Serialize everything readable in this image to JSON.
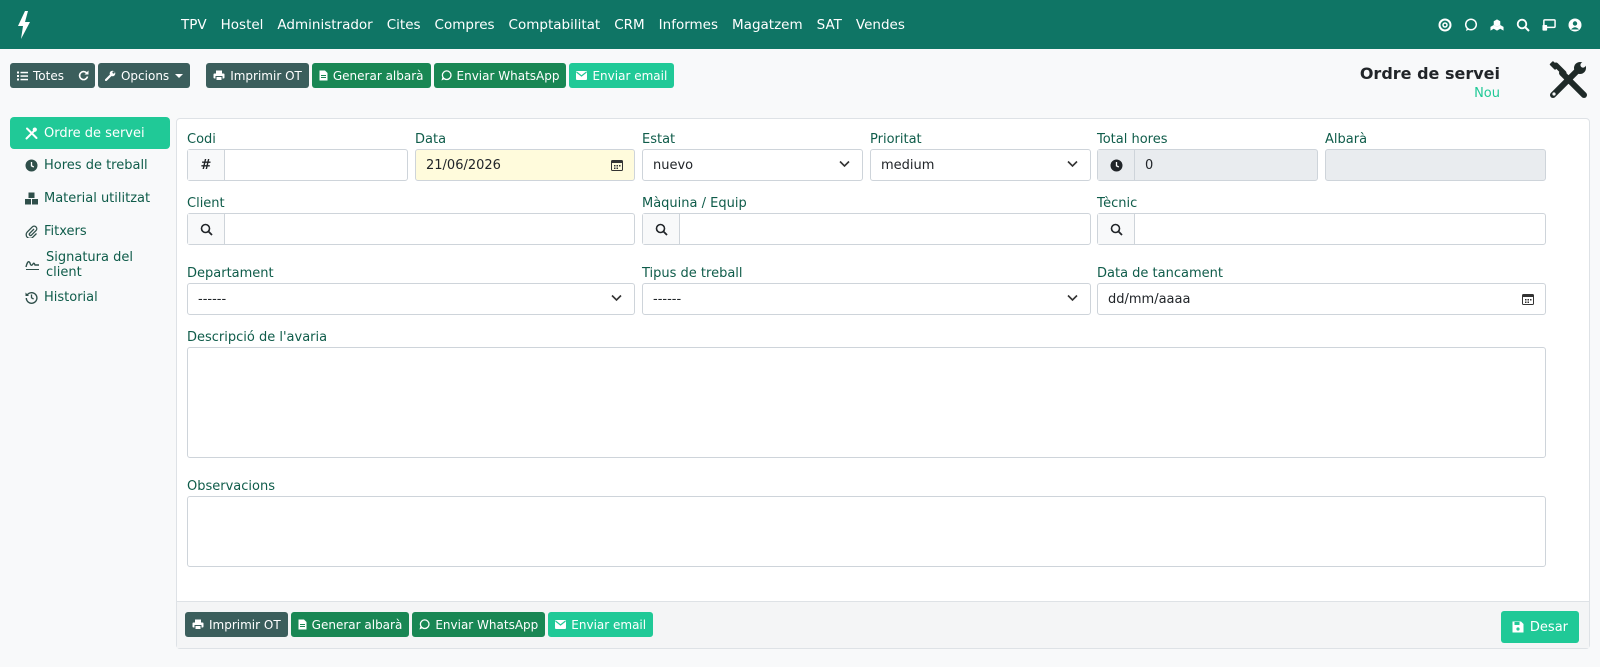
{
  "navbar": {
    "menu": [
      "TPV",
      "Hostel",
      "Administrador",
      "Cites",
      "Compres",
      "Comptabilitat",
      "CRM",
      "Informes",
      "Magatzem",
      "SAT",
      "Vendes"
    ],
    "icons": [
      "support-icon",
      "whatsapp-icon",
      "modules-icon",
      "search-icon",
      "screen-icon",
      "user-icon"
    ]
  },
  "toolbar": {
    "all_label": "Totes",
    "options_label": "Opcions",
    "print_label": "Imprimir OT",
    "invoice_label": "Generar albarà",
    "whatsapp_label": "Enviar WhatsApp",
    "email_label": "Enviar email"
  },
  "header": {
    "title": "Ordre de servei",
    "subtitle": "Nou"
  },
  "sidebar": {
    "items": [
      {
        "label": "Ordre de servei",
        "icon": "tools-icon"
      },
      {
        "label": "Hores de treball",
        "icon": "clock-icon"
      },
      {
        "label": "Material utilitzat",
        "icon": "boxes-icon"
      },
      {
        "label": "Fitxers",
        "icon": "paperclip-icon"
      },
      {
        "label": "Signatura del client",
        "icon": "signature-icon"
      },
      {
        "label": "Historial",
        "icon": "history-icon"
      }
    ]
  },
  "form": {
    "codi": {
      "label": "Codi",
      "value": ""
    },
    "data": {
      "label": "Data",
      "value": "21/06/2026"
    },
    "estat": {
      "label": "Estat",
      "value": "nuevo"
    },
    "prioritat": {
      "label": "Prioritat",
      "value": "medium"
    },
    "total_hores": {
      "label": "Total hores",
      "value": "0"
    },
    "albara": {
      "label": "Albarà",
      "value": ""
    },
    "client": {
      "label": "Client",
      "value": ""
    },
    "maquina": {
      "label": "Màquina / Equip",
      "value": ""
    },
    "tecnic": {
      "label": "Tècnic",
      "value": ""
    },
    "departament": {
      "label": "Departament",
      "value": "------"
    },
    "tipus": {
      "label": "Tipus de treball",
      "value": "------"
    },
    "data_tancament": {
      "label": "Data de tancament",
      "value": "dd/mm/aaaa"
    },
    "descripcio": {
      "label": "Descripció de l'avaria",
      "value": ""
    },
    "observacions": {
      "label": "Observacions",
      "value": ""
    }
  },
  "footer": {
    "print_label": "Imprimir OT",
    "invoice_label": "Generar albarà",
    "whatsapp_label": "Enviar WhatsApp",
    "email_label": "Enviar email",
    "save_label": "Desar"
  },
  "colors": {
    "navbar": "#0f7565",
    "accent": "#20c997",
    "green": "#198754",
    "dark": "#3b5e5c"
  }
}
